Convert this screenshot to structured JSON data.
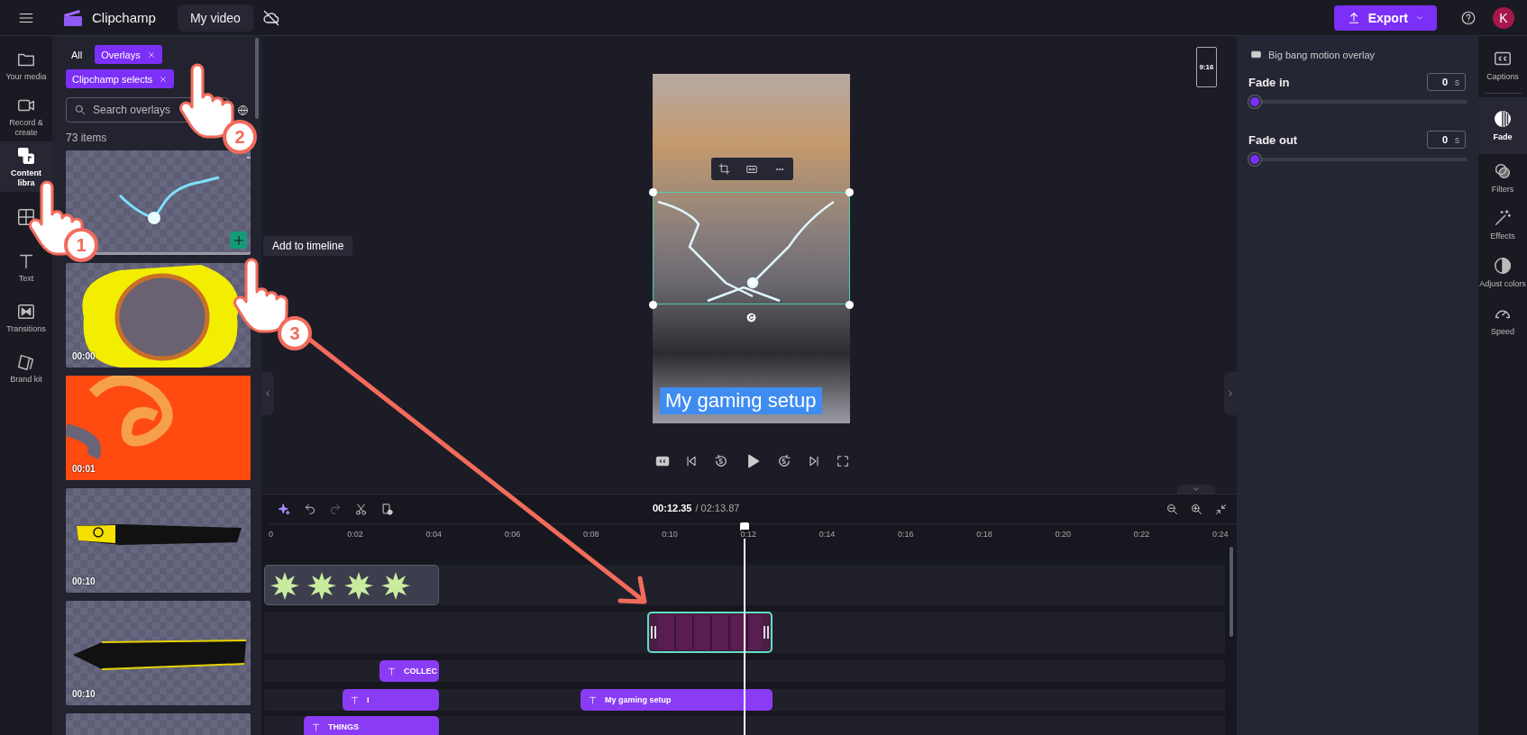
{
  "top_bar": {
    "app_name": "Clipchamp",
    "project_title": "My video",
    "export_label": "Export",
    "avatar_initial": "K"
  },
  "nav_rail": [
    {
      "label": "Your media",
      "selected": false
    },
    {
      "label": "Record & create",
      "selected": false
    },
    {
      "label": "Content libra",
      "selected": true
    },
    {
      "selected": false
    },
    {
      "label": "Text",
      "selected": false
    },
    {
      "label": "Transitions",
      "selected": false
    },
    {
      "label": "Brand kit",
      "selected": false
    }
  ],
  "library_panel": {
    "filters": [
      {
        "label": "All",
        "selected": false
      },
      {
        "label": "Overlays",
        "selected": true
      },
      {
        "label": "Clipchamp selects",
        "selected": true
      }
    ],
    "search": {
      "placeholder": "Search overlays"
    },
    "item_count": "73 items",
    "items": [
      {
        "kind": "lightning",
        "hovered": true
      },
      {
        "kind": "ring",
        "duration": "00:00",
        "hovered": false
      },
      {
        "kind": "swirl",
        "duration": "00:01",
        "hovered": false
      },
      {
        "kind": "brush_bulb",
        "duration": "00:10",
        "hovered": false
      },
      {
        "kind": "brush",
        "duration": "00:10",
        "hovered": false
      },
      {
        "kind": "blank",
        "hovered": false
      }
    ],
    "tooltip": "Add to timeline"
  },
  "preview": {
    "aspect_ratio": "9:16",
    "caption": "My gaming setup"
  },
  "timeline": {
    "current_time": "00:12.35",
    "total_time": "/ 02:13.87",
    "ruler": [
      "0",
      "0:02",
      "0:04",
      "0:06",
      "0:08",
      "0:10",
      "0:12",
      "0:14",
      "0:16",
      "0:18",
      "0:20",
      "0:22",
      "0:24"
    ],
    "clips": [
      {
        "kind": "sticker",
        "selected": false
      },
      {
        "kind": "overlay",
        "selected": true
      },
      {
        "kind": "text",
        "label": "COLLEC",
        "selected": false
      },
      {
        "kind": "text",
        "label": "I",
        "selected": false
      },
      {
        "kind": "text",
        "label": "My gaming setup",
        "selected": false
      },
      {
        "kind": "text",
        "label": "THINGS",
        "selected": false
      }
    ]
  },
  "properties_panel": {
    "clip_name": "Big bang motion overlay",
    "controls": [
      {
        "label": "Fade in",
        "value": "0",
        "unit": "s",
        "level": 0
      },
      {
        "label": "Fade out",
        "value": "0",
        "unit": "s",
        "level": 0
      }
    ]
  },
  "right_rail": [
    {
      "label": "Captions",
      "selected": false
    },
    {
      "label": "Fade",
      "selected": true
    },
    {
      "label": "Filters",
      "selected": false
    },
    {
      "label": "Effects",
      "selected": false
    },
    {
      "label": "Adjust colors",
      "selected": false
    },
    {
      "label": "Speed",
      "selected": false
    }
  ],
  "annotations": [
    "1",
    "2",
    "3"
  ]
}
